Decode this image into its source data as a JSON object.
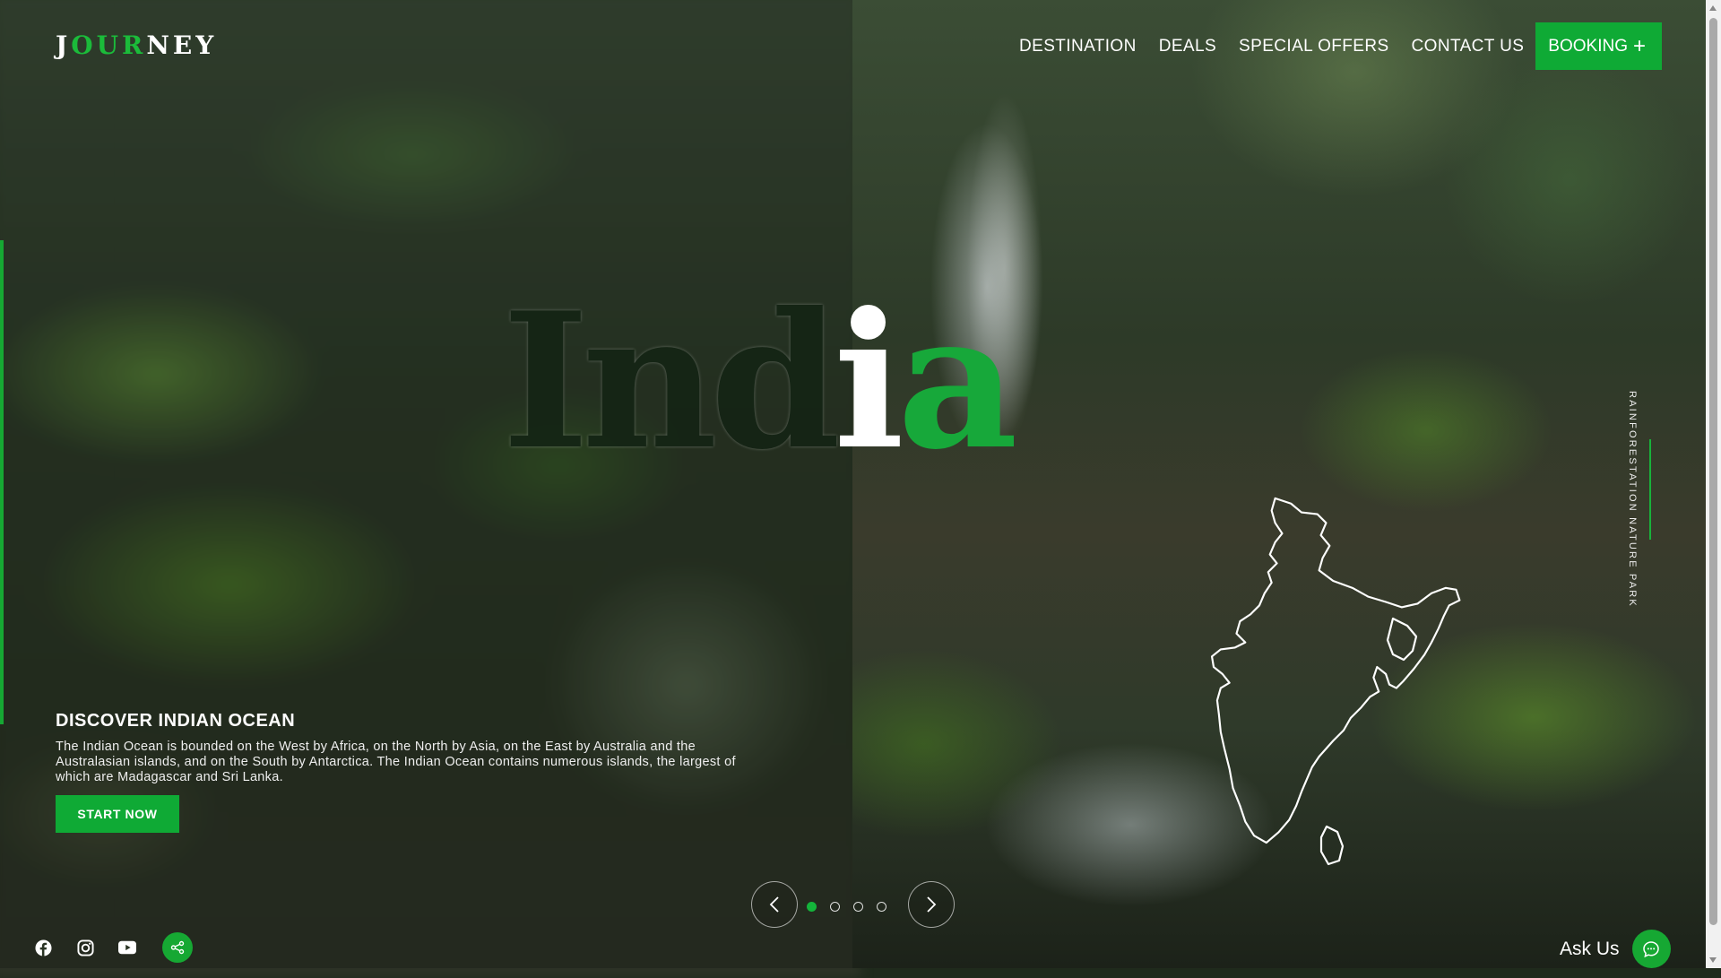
{
  "brand": {
    "logo_part1": "J",
    "logo_part2": "OUR",
    "logo_part3": "NEY"
  },
  "nav": {
    "items": [
      "DESTINATION",
      "DEALS",
      "SPECIAL OFFERS",
      "CONTACT US"
    ],
    "booking_label": "BOOKING",
    "booking_icon": "plus-icon"
  },
  "hero": {
    "title_letters": [
      "I",
      "n",
      "d",
      "i",
      "a"
    ],
    "side_label": "RAINFORESTATION NATURE PARK"
  },
  "info": {
    "title": "DISCOVER INDIAN OCEAN",
    "text": "The Indian Ocean is bounded on the West by Africa, on the North by Asia, on the East by Australia and the Australasian islands, and on the South by Antarctica. The Indian Ocean contains numerous islands, the largest of which are Madagascar and Sri Lanka.",
    "button_label": "START NOW"
  },
  "carousel": {
    "prev_icon": "chevron-left-icon",
    "next_icon": "chevron-right-icon",
    "slide_count": 4,
    "active_index": 0
  },
  "social": {
    "icons": [
      "facebook-icon",
      "instagram-icon",
      "youtube-icon",
      "share-icon"
    ]
  },
  "chat": {
    "label": "Ask Us",
    "icon": "chat-icon"
  },
  "colors": {
    "accent": "#0faa35",
    "text": "#ffffff"
  }
}
